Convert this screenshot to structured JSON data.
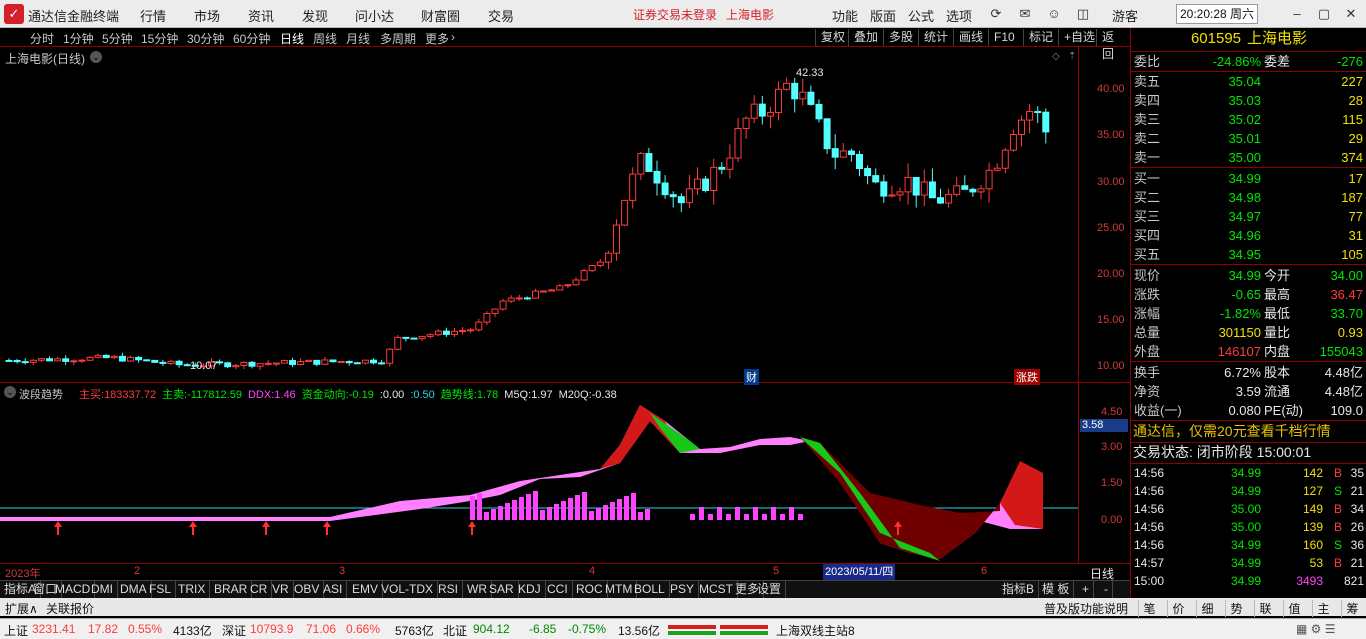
{
  "titlebar": {
    "app_title": "通达信金融终端",
    "menus": [
      "行情",
      "市场",
      "资讯",
      "发现",
      "问小达",
      "财富圈",
      "交易"
    ],
    "warning": "证券交易未登录",
    "stock_link": "上海电影",
    "controls": [
      "功能",
      "版面",
      "公式",
      "选项"
    ],
    "guest": "游客",
    "clock": "20:20:28 周六"
  },
  "periodbar": {
    "periods": [
      "分时",
      "1分钟",
      "5分钟",
      "15分钟",
      "30分钟",
      "60分钟",
      "日线",
      "周线",
      "月线",
      "多周期",
      "更多"
    ],
    "active": "日线",
    "tools": [
      "复权",
      "叠加",
      "多股",
      "统计",
      "画线",
      "F10",
      "标记",
      "+自选",
      "返回"
    ]
  },
  "mainchart": {
    "title": "上海电影(日线)",
    "y_labels": [
      "40.00",
      "35.00",
      "30.00",
      "25.00",
      "20.00",
      "15.00",
      "10.00"
    ],
    "high_label": "42.33",
    "low_label": "10.07",
    "markers": [
      "财",
      "涨跌"
    ]
  },
  "subchart": {
    "title": "波段趋势",
    "indicators": [
      {
        "label": "主买:",
        "value": "183337.72",
        "color": "#ff3b3b"
      },
      {
        "label": "主卖:",
        "value": "-117812.59",
        "color": "#00e600"
      },
      {
        "label": "DDX:",
        "value": "1.46",
        "color": "#ff44ff"
      },
      {
        "label": "资金动向:",
        "value": "-0.19",
        "color": "#00e600"
      },
      {
        "label": ":",
        "value": "0.00",
        "color": "#e8e8e8"
      },
      {
        "label": ":",
        "value": "0.50",
        "color": "#2ad6e6"
      },
      {
        "label": "趋势线:",
        "value": "1.78",
        "color": "#00e600"
      },
      {
        "label": "M5Q:",
        "value": "1.97",
        "color": "#e8e8e8"
      },
      {
        "label": "M20Q:",
        "value": "-0.38",
        "color": "#e8e8e8"
      }
    ],
    "y_labels": [
      "4.50",
      "3.00",
      "1.50",
      "0.00"
    ],
    "current": "3.58"
  },
  "datebar": {
    "labels": [
      "2023年",
      "2",
      "3",
      "4",
      "5",
      "6"
    ],
    "cursor_date": "2023/05/11/四",
    "right_label": "日线"
  },
  "tabs": [
    "指标A",
    "窗口",
    "MACD",
    "DMI",
    "DMA",
    "FSL",
    "TRIX",
    "BRAR",
    "CR",
    "VR",
    "OBV",
    "ASI",
    "EMV",
    "VOL-TDX",
    "RSI",
    "WR",
    "SAR",
    "KDJ",
    "CCI",
    "ROC",
    "MTM",
    "BOLL",
    "PSY",
    "MCST",
    "更多",
    "设置"
  ],
  "tabs_right": [
    "指标B",
    "模 板",
    "+",
    "-"
  ],
  "extbar": {
    "left": [
      "扩展∧",
      "关联报价"
    ],
    "right": "普及版功能说明",
    "icons": [
      "笔",
      "价",
      "细",
      "势",
      "联",
      "值",
      "主",
      "筹"
    ]
  },
  "rpanel": {
    "code": "601595",
    "name": "上海电影",
    "wei_bi": {
      "label": "委比",
      "value": "-24.86%",
      "label2": "委差",
      "value2": "-276"
    },
    "asks": [
      {
        "label": "卖五",
        "price": "35.04",
        "vol": "227"
      },
      {
        "label": "卖四",
        "price": "35.03",
        "vol": "28"
      },
      {
        "label": "卖三",
        "price": "35.02",
        "vol": "115"
      },
      {
        "label": "卖二",
        "price": "35.01",
        "vol": "29"
      },
      {
        "label": "卖一",
        "price": "35.00",
        "vol": "374"
      }
    ],
    "bids": [
      {
        "label": "买一",
        "price": "34.99",
        "vol": "17"
      },
      {
        "label": "买二",
        "price": "34.98",
        "vol": "187"
      },
      {
        "label": "买三",
        "price": "34.97",
        "vol": "77"
      },
      {
        "label": "买四",
        "price": "34.96",
        "vol": "31"
      },
      {
        "label": "买五",
        "price": "34.95",
        "vol": "105"
      }
    ],
    "quote": [
      {
        "l1": "现价",
        "v1": "34.99",
        "c1": "green",
        "l2": "今开",
        "v2": "34.00",
        "c2": "green"
      },
      {
        "l1": "涨跌",
        "v1": "-0.65",
        "c1": "green",
        "l2": "最高",
        "v2": "36.47",
        "c2": "red"
      },
      {
        "l1": "涨幅",
        "v1": "-1.82%",
        "c1": "green",
        "l2": "最低",
        "v2": "33.70",
        "c2": "green"
      },
      {
        "l1": "总量",
        "v1": "301150",
        "c1": "yellow",
        "l2": "量比",
        "v2": "0.93",
        "c2": "yellow"
      },
      {
        "l1": "外盘",
        "v1": "146107",
        "c1": "red",
        "l2": "内盘",
        "v2": "155043",
        "c2": "green"
      }
    ],
    "fundamentals": [
      {
        "l1": "换手",
        "v1": "6.72%",
        "l2": "股本",
        "v2": "4.48亿"
      },
      {
        "l1": "净资",
        "v1": "3.59",
        "l2": "流通",
        "v2": "4.48亿"
      },
      {
        "l1": "收益(一)",
        "v1": "0.080",
        "l2": "PE(动)",
        "v2": "109.0"
      }
    ],
    "promo": "通达信，仅需20元查看千档行情",
    "trade_state": "交易状态: 闭市阶段 15:00:01",
    "ticks": [
      {
        "t": "14:56",
        "p": "34.99",
        "v": "142",
        "s": "B",
        "n": "35"
      },
      {
        "t": "14:56",
        "p": "34.99",
        "v": "127",
        "s": "S",
        "n": "21"
      },
      {
        "t": "14:56",
        "p": "35.00",
        "v": "149",
        "s": "B",
        "n": "34"
      },
      {
        "t": "14:56",
        "p": "35.00",
        "v": "139",
        "s": "B",
        "n": "26"
      },
      {
        "t": "14:56",
        "p": "34.99",
        "v": "160",
        "s": "S",
        "n": "36"
      },
      {
        "t": "14:57",
        "p": "34.99",
        "v": "53",
        "s": "B",
        "n": "21"
      },
      {
        "t": "15:00",
        "p": "34.99",
        "v": "3493",
        "s": "",
        "n": "821"
      }
    ]
  },
  "statusbar": {
    "sh_label": "上证",
    "sh_val": "3231.41",
    "sh_chg": "17.82",
    "sh_pct": "0.55%",
    "sh_amt": "4133亿",
    "sz_label": "深证",
    "sz_val": "10793.9",
    "sz_chg": "71.06",
    "sz_pct": "0.66%",
    "sz_amt": "5763亿",
    "bz_label": "北证",
    "bz_val": "904.12",
    "bz_chg": "-6.85",
    "bz_pct": "-0.75%",
    "bz_amt": "13.56亿",
    "server": "上海双线主站8"
  },
  "colors": {
    "up": "#ff3b3b",
    "down": "#00e600",
    "axis": "#8b0000",
    "cyan_candle": "#54ffff"
  }
}
